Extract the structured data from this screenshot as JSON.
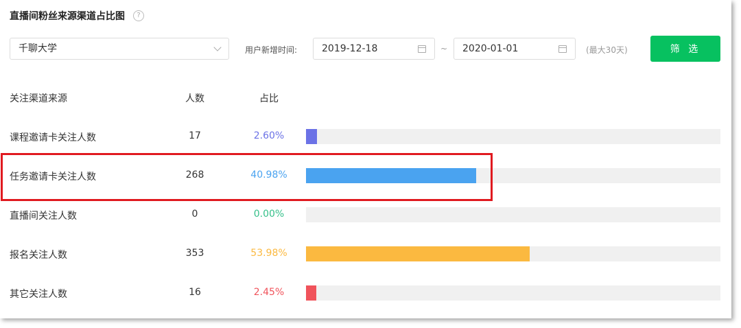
{
  "header": {
    "title": "直播间粉丝来源渠道占比图",
    "help_icon": "question-circle-icon"
  },
  "filters": {
    "school_select": {
      "value": "千聊大学"
    },
    "time_label": "用户新增时间:",
    "start_date": "2019-12-18",
    "separator": "~",
    "end_date": "2020-01-01",
    "max_note": "(最大30天)",
    "filter_button": "筛 选"
  },
  "table": {
    "headers": {
      "source": "关注渠道来源",
      "count": "人数",
      "ratio": "占比"
    },
    "rows": [
      {
        "label": "课程邀请卡关注人数",
        "count": "17",
        "percent": "2.60%",
        "value": 2.6,
        "color": "#6b72e6"
      },
      {
        "label": "任务邀请卡关注人数",
        "count": "268",
        "percent": "40.98%",
        "value": 40.98,
        "color": "#4aa3f0"
      },
      {
        "label": "直播间关注人数",
        "count": "0",
        "percent": "0.00%",
        "value": 0.0,
        "color": "#36c08a"
      },
      {
        "label": "报名关注人数",
        "count": "353",
        "percent": "53.98%",
        "value": 53.98,
        "color": "#fbb940"
      },
      {
        "label": "其它关注人数",
        "count": "16",
        "percent": "2.45%",
        "value": 2.45,
        "color": "#f0535b"
      }
    ]
  },
  "chart_data": {
    "type": "bar",
    "categories": [
      "课程邀请卡关注人数",
      "任务邀请卡关注人数",
      "直播间关注人数",
      "报名关注人数",
      "其它关注人数"
    ],
    "values": [
      2.6,
      40.98,
      0.0,
      53.98,
      2.45
    ],
    "counts": [
      17,
      268,
      0,
      353,
      16
    ],
    "xlim": [
      0,
      100
    ]
  },
  "colors": {
    "accent": "#07c160",
    "highlight": "#e0191f",
    "track": "#f0f0f0"
  }
}
